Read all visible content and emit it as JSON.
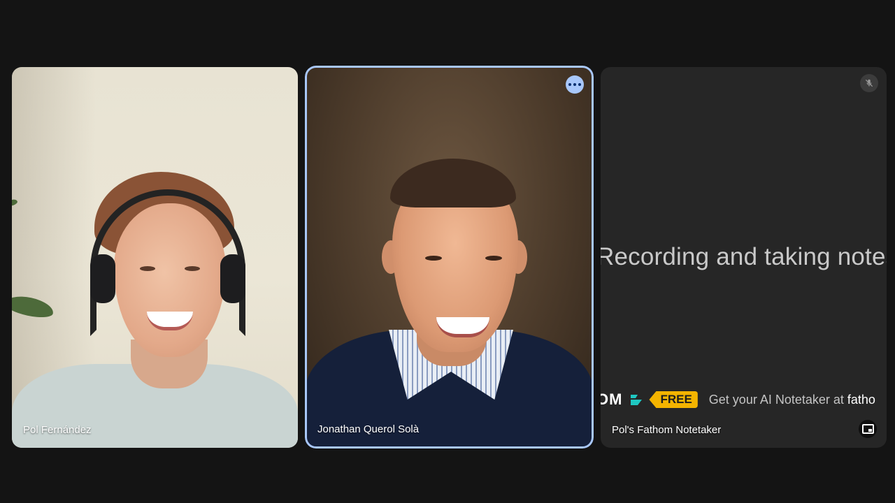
{
  "participants": [
    {
      "name": "Pol Fernández"
    },
    {
      "name": "Jonathan Querol Solà"
    },
    {
      "name": "Pol's Fathom Notetaker"
    }
  ],
  "notetaker": {
    "status_text": "Recording and taking notes",
    "brand_partial": "OM",
    "free_label": "FREE",
    "cta_prefix": "Get your AI Notetaker at ",
    "cta_link": "fatho"
  },
  "icons": {
    "more_options": "more-horiz-icon",
    "muted": "mic-off-icon",
    "fullscreen": "fullscreen-icon",
    "fathom_logo": "fathom-logo-icon"
  },
  "colors": {
    "background": "#141414",
    "active_ring": "#a8c7fa",
    "notetaker_tile": "#262626",
    "free_tag": "#f4b400",
    "fathom_accent": "#1fc7c1"
  }
}
